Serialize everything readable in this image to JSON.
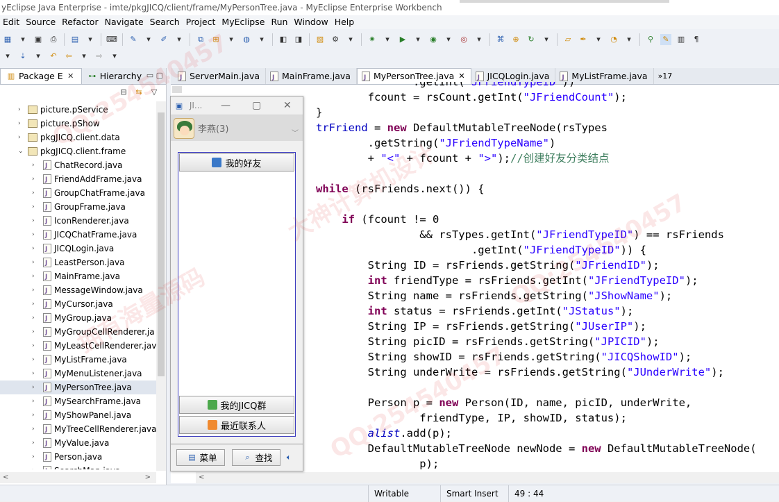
{
  "window": {
    "title": "yEclipse Java Enterprise - imte/pkgJICQ/client/frame/MyPersonTree.java - MyEclipse Enterprise Workbench"
  },
  "menu": [
    "Edit",
    "Source",
    "Refactor",
    "Navigate",
    "Search",
    "Project",
    "MyEclipse",
    "Run",
    "Window",
    "Help"
  ],
  "left_panel": {
    "tabs": [
      {
        "label": "Package E"
      },
      {
        "label": "Hierarchy"
      }
    ],
    "tree": [
      {
        "label": "picture.pService",
        "type": "package",
        "expanded": false
      },
      {
        "label": "picture.pShow",
        "type": "package",
        "expanded": false
      },
      {
        "label": "pkgJICQ.client.data",
        "type": "package",
        "expanded": false
      },
      {
        "label": "pkgJICQ.client.frame",
        "type": "package",
        "expanded": true
      },
      {
        "label": "ChatRecord.java",
        "type": "file"
      },
      {
        "label": "FriendAddFrame.java",
        "type": "file"
      },
      {
        "label": "GroupChatFrame.java",
        "type": "file"
      },
      {
        "label": "GroupFrame.java",
        "type": "file"
      },
      {
        "label": "IconRenderer.java",
        "type": "file"
      },
      {
        "label": "JICQChatFrame.java",
        "type": "file"
      },
      {
        "label": "JICQLogin.java",
        "type": "file"
      },
      {
        "label": "LeastPerson.java",
        "type": "file"
      },
      {
        "label": "MainFrame.java",
        "type": "file"
      },
      {
        "label": "MessageWindow.java",
        "type": "file"
      },
      {
        "label": "MyCursor.java",
        "type": "file"
      },
      {
        "label": "MyGroup.java",
        "type": "file"
      },
      {
        "label": "MyGroupCellRenderer.ja",
        "type": "file"
      },
      {
        "label": "MyLeastCellRenderer.java",
        "type": "file"
      },
      {
        "label": "MyListFrame.java",
        "type": "file"
      },
      {
        "label": "MyMenuListener.java",
        "type": "file"
      },
      {
        "label": "MyPersonTree.java",
        "type": "file",
        "selected": true
      },
      {
        "label": "MySearchFrame.java",
        "type": "file"
      },
      {
        "label": "MyShowPanel.java",
        "type": "file"
      },
      {
        "label": "MyTreeCellRenderer.java",
        "type": "file"
      },
      {
        "label": "MyValue.java",
        "type": "file"
      },
      {
        "label": "Person.java",
        "type": "file"
      },
      {
        "label": "SearchMan.java",
        "type": "file"
      }
    ]
  },
  "editor": {
    "tabs": [
      {
        "label": "ServerMain.java",
        "active": false
      },
      {
        "label": "MainFrame.java",
        "active": false
      },
      {
        "label": "MyPersonTree.java",
        "active": true
      },
      {
        "label": "JICQLogin.java",
        "active": false
      },
      {
        "label": "MyListFrame.java",
        "active": false
      }
    ],
    "overflow": "»17"
  },
  "jicq": {
    "title": "JI...",
    "user": "李燕(3)",
    "group_friends": "我的好友",
    "group_qun": "我的JICQ群",
    "group_recent": "最近联系人",
    "menu_btn": "菜单",
    "search_btn": "查找"
  },
  "status": {
    "writable": "Writable",
    "insert": "Smart Insert",
    "position": "49 : 44"
  },
  "watermarks": [
    "QQ:254540457",
    "大神计算机设计",
    "拥有海量源码"
  ],
  "colors": {
    "keyword": "#7f0055",
    "string": "#2a00ff",
    "comment": "#3f7f5f",
    "field": "#0000c0"
  }
}
